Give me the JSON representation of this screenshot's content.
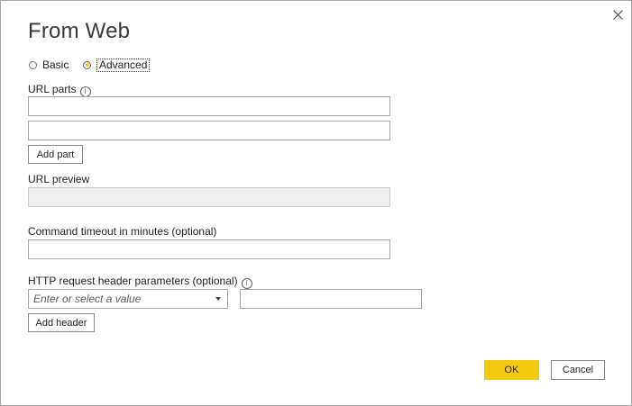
{
  "dialog": {
    "title": "From Web",
    "close_icon": "close-icon"
  },
  "mode": {
    "basic_label": "Basic",
    "advanced_label": "Advanced",
    "selected": "Advanced"
  },
  "url_parts": {
    "label": "URL parts",
    "info_icon": "info-icon",
    "info_glyph": "i",
    "parts": [
      "",
      ""
    ],
    "add_part_label": "Add part"
  },
  "url_preview": {
    "label": "URL preview",
    "value": ""
  },
  "command_timeout": {
    "label": "Command timeout in minutes (optional)",
    "value": ""
  },
  "http_headers": {
    "label": "HTTP request header parameters (optional)",
    "info_icon": "info-icon",
    "info_glyph": "i",
    "name_placeholder": "Enter or select a value",
    "value": "",
    "add_header_label": "Add header"
  },
  "footer": {
    "ok_label": "OK",
    "cancel_label": "Cancel"
  },
  "colors": {
    "accent": "#f2c811",
    "border": "#a6a6a6",
    "disabled_bg": "#f0f0f0"
  }
}
